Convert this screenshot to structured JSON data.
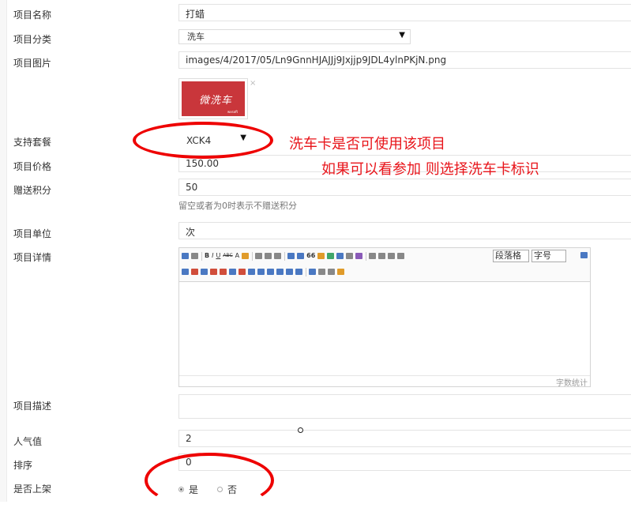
{
  "labels": {
    "name": "项目名称",
    "category": "项目分类",
    "image": "项目图片",
    "package": "支持套餐",
    "price": "项目价格",
    "points": "赠送积分",
    "unit": "项目单位",
    "detail": "项目详情",
    "desc": "项目描述",
    "popularity": "人气值",
    "sort": "排序",
    "listed": "是否上架"
  },
  "values": {
    "name": "打蜡",
    "category": "洗车",
    "image_path": "images/4/2017/05/Ln9GnnHJAJJj9Jxjjp9JDL4ylnPKjN.png",
    "package": "XCK4",
    "price": "150.00",
    "points": "50",
    "unit": "次",
    "desc": "",
    "popularity": "2",
    "sort": "0"
  },
  "hints": {
    "points": "留空或者为0时表示不赠送积分"
  },
  "thumbnail": {
    "title": "微洗车",
    "subtitle": "wxsoft",
    "remove": "×"
  },
  "editor": {
    "paragraph_combo": "段落格",
    "fontsize_combo": "字号",
    "word_count": "字数统计",
    "toolbar_row1": [
      "B",
      "I",
      "U",
      "ABC",
      "A",
      "66"
    ]
  },
  "radios": {
    "yes": "是",
    "no": "否",
    "selected": "yes"
  },
  "annotations": {
    "line1": "洗车卡是否可使用该项目",
    "line2": "如果可以看参加 则选择洗车卡标识"
  },
  "colors": {
    "annotation_red": "#e8141a",
    "thumb_bg": "#c9363b"
  }
}
